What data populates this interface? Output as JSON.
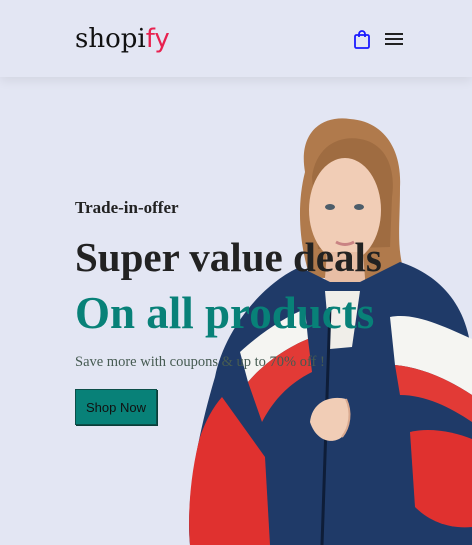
{
  "header": {
    "logo_main": "shopi",
    "logo_accent": "fy",
    "icons": [
      "shopping-bag-icon",
      "hamburger-menu-icon"
    ]
  },
  "hero": {
    "eyebrow": "Trade-in-offer",
    "headline": "Super value deals",
    "subheadline": "On all products",
    "description": "Save more with coupons & up to 70% off !",
    "cta_label": "Shop Now"
  },
  "colors": {
    "background": "#e3e6f3",
    "brand_teal": "#088178",
    "logo_accent": "#e8214f"
  }
}
